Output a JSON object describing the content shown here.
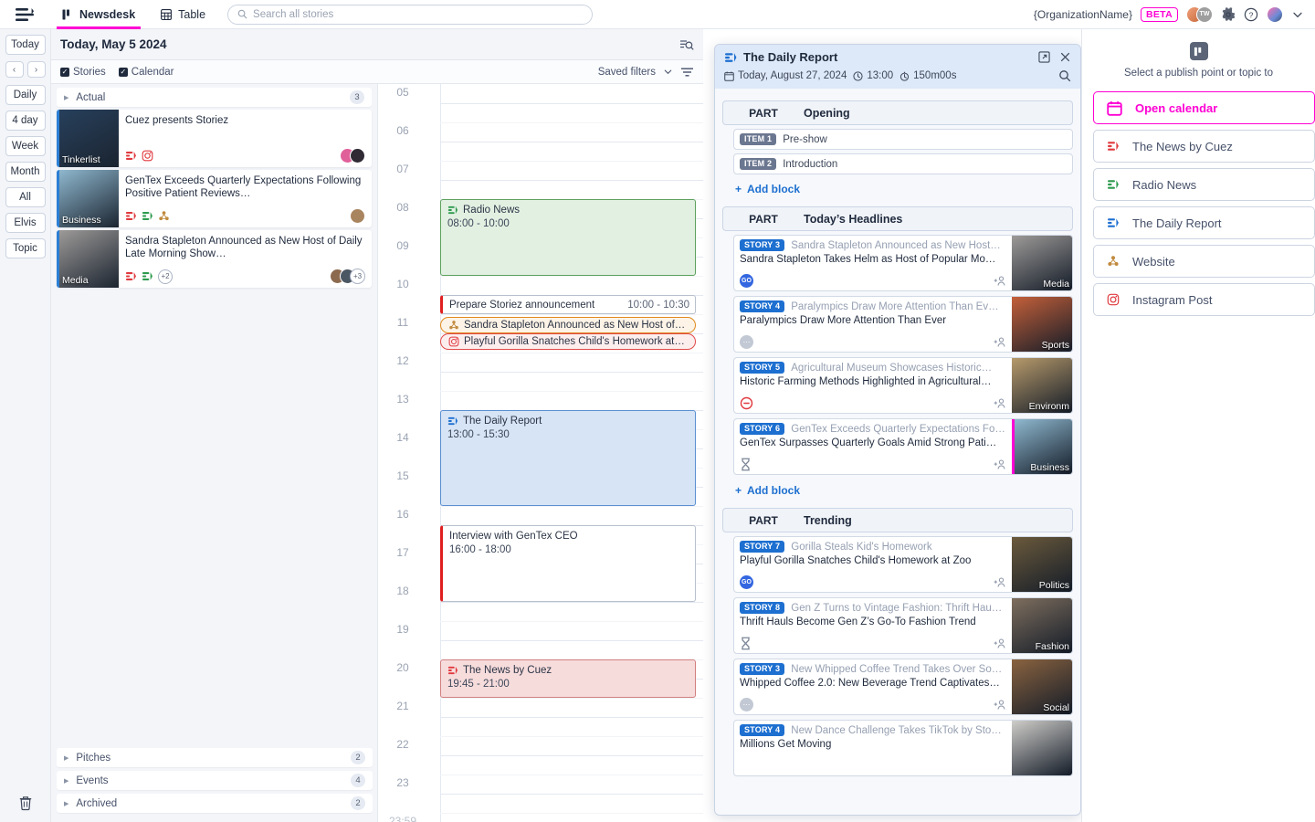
{
  "topbar": {
    "logo_icon": "menu-logo-icon",
    "tabs": [
      {
        "label": "Newsdesk",
        "icon": "board-icon",
        "active": true
      },
      {
        "label": "Table",
        "icon": "table-icon",
        "active": false
      }
    ],
    "search_placeholder": "Search all stories",
    "search_value": "",
    "org_name": "{OrganizationName}",
    "beta_label": "BETA",
    "collab_initials": "TW",
    "gear_icon": "gear-icon",
    "help_icon": "help-icon",
    "chevron_icon": "chevron-down-icon"
  },
  "rail": {
    "today_label": "Today",
    "prev_label": "‹",
    "next_label": "›",
    "views": [
      "Daily",
      "4 day",
      "Week",
      "Month",
      "All",
      "Elvis",
      "Topic"
    ],
    "trash_icon": "trash-icon"
  },
  "panel": {
    "date_title": "Today, May 5 2024",
    "search_settings_icon": "search-settings-icon"
  },
  "filterbar": {
    "stories_label": "Stories",
    "stories_checked": true,
    "calendar_label": "Calendar",
    "calendar_checked": true,
    "saved_filters_label": "Saved filters",
    "filter_icon": "filter-icon"
  },
  "stories": {
    "groups": [
      {
        "label": "Actual",
        "count": "3"
      }
    ],
    "cards": [
      {
        "title": "Cuez presents Storiez",
        "tag": "Tinkerlist",
        "accent": "#2b7fd4",
        "thumb_tone": "#27405c",
        "publish_icons": [
          "cuez-red-icon",
          "instagram-icon"
        ],
        "extra_count": "",
        "avatars": [
          "#e0609a",
          "#2f2a33"
        ],
        "avatar_extra": ""
      },
      {
        "title": "GenTex Exceeds Quarterly Expectations Following Positive Patient Reviews…",
        "tag": "Business",
        "accent": "#2b7fd4",
        "thumb_tone": "#8fb8cf",
        "publish_icons": [
          "cuez-red-icon",
          "cuez-green-icon",
          "website-icon"
        ],
        "extra_count": "",
        "avatars": [
          "#a9855f"
        ],
        "avatar_extra": ""
      },
      {
        "title": "Sandra Stapleton Announced as New Host of Daily Late Morning Show…",
        "tag": "Media",
        "accent": "#2b7fd4",
        "thumb_tone": "#9d9a98",
        "publish_icons": [
          "cuez-red-icon",
          "cuez-green-icon"
        ],
        "extra_count": "+2",
        "avatars": [
          "#8c6a4f",
          "#4b5763"
        ],
        "avatar_extra": "+3"
      }
    ],
    "bottom_groups": [
      {
        "label": "Pitches",
        "count": "2"
      },
      {
        "label": "Events",
        "count": "4"
      },
      {
        "label": "Archived",
        "count": "2"
      }
    ]
  },
  "calendar": {
    "hours": [
      "05",
      "06",
      "07",
      "08",
      "09",
      "10",
      "11",
      "12",
      "13",
      "14",
      "15",
      "16",
      "17",
      "18",
      "19",
      "20",
      "21",
      "22",
      "23"
    ],
    "end_label": "23:59",
    "events": [
      {
        "kind": "block",
        "style": "green",
        "icon": "cuez-green-icon",
        "title": "Radio News",
        "time": "08:00 - 10:00",
        "start": 8.0,
        "end": 10.0
      },
      {
        "kind": "task",
        "style": "task",
        "title": "Prepare Storiez announcement",
        "time": "10:00 - 10:30",
        "start": 10.5,
        "end": 11.0
      },
      {
        "kind": "pill",
        "style": "orange",
        "icon": "website-icon",
        "title": "Sandra Stapleton Announced as New Host of…",
        "start": 11.08
      },
      {
        "kind": "pill",
        "style": "red",
        "icon": "instagram-icon",
        "title": "Playful Gorilla Snatches Child's Homework at…",
        "start": 11.5
      },
      {
        "kind": "block",
        "style": "blue",
        "icon": "cuez-blue-icon",
        "title": "The Daily Report",
        "time": "13:00 - 15:30",
        "start": 13.5,
        "end": 16.0
      },
      {
        "kind": "task",
        "style": "task",
        "title": "Interview with GenTex CEO",
        "time": "16:00 - 18:00",
        "start": 16.5,
        "end": 18.5
      },
      {
        "kind": "block",
        "style": "red",
        "icon": "cuez-red-icon",
        "title": "The News by Cuez",
        "time": "19:45 - 21:00",
        "start": 20.0,
        "end": 21.0
      }
    ]
  },
  "rundown": {
    "title": "The Daily Report",
    "icon": "cuez-blue-icon",
    "open_external_icon": "open-external-icon",
    "close_icon": "close-icon",
    "date": "Today, August 27, 2024",
    "start_time": "13:00",
    "duration": "150m00s",
    "search_icon": "search-icon",
    "add_block_label": "Add block",
    "part_label": "PART",
    "parts": [
      {
        "name": "Opening",
        "items": [
          {
            "type": "item",
            "badge": "ITEM 1",
            "text": "Pre-show"
          },
          {
            "type": "item",
            "badge": "ITEM 2",
            "text": "Introduction"
          }
        ]
      },
      {
        "name": "Today’s Headlines",
        "items": [
          {
            "type": "story",
            "badge": "STORY 3",
            "slug": "Sandra Stapleton Announced as New Host…",
            "headline": "Sandra Stapleton Takes Helm as Host of Popular Mo…",
            "status_icon": "go-badge-icon",
            "tag": "Media",
            "thumb_tone": "#9d9a98",
            "assign_icon": "add-person-icon",
            "accent": ""
          },
          {
            "type": "story",
            "badge": "STORY 4",
            "slug": "Paralympics Draw More Attention Than Ev…",
            "headline": "Paralympics Draw More Attention Than Ever",
            "status_icon": "dots-icon",
            "tag": "Sports",
            "thumb_tone": "#c4603a",
            "assign_icon": "add-person-icon",
            "accent": ""
          },
          {
            "type": "story",
            "badge": "STORY 5",
            "slug": "Agricultural Museum Showcases Historic…",
            "headline": "Historic Farming Methods Highlighted in Agricultural…",
            "status_icon": "blocked-icon",
            "tag": "Environm",
            "thumb_tone": "#b79a6b",
            "assign_icon": "add-person-icon",
            "accent": ""
          },
          {
            "type": "story",
            "badge": "STORY 6",
            "slug": "GenTex Exceeds Quarterly Expectations Fo…",
            "headline": "GenTex Surpasses Quarterly Goals Amid Strong Pati…",
            "status_icon": "hourglass-icon",
            "tag": "Business",
            "thumb_tone": "#8fb8cf",
            "assign_icon": "add-person-icon",
            "accent": "#ff00d4"
          }
        ]
      },
      {
        "name": "Trending",
        "items": [
          {
            "type": "story",
            "badge": "STORY 7",
            "slug": "Gorilla Steals Kid's Homework",
            "headline": "Playful Gorilla Snatches Child's Homework at Zoo",
            "status_icon": "go-badge-icon",
            "tag": "Politics",
            "thumb_tone": "#6b5a3c",
            "assign_icon": "add-person-icon",
            "accent": ""
          },
          {
            "type": "story",
            "badge": "STORY 8",
            "slug": "Gen Z Turns to Vintage Fashion: Thrift Hau…",
            "headline": "Thrift Hauls Become Gen Z’s Go-To Fashion Trend",
            "status_icon": "hourglass-icon",
            "tag": "Fashion",
            "thumb_tone": "#7e6e5e",
            "assign_icon": "add-person-icon",
            "accent": ""
          },
          {
            "type": "story",
            "badge": "STORY 3",
            "slug": "New Whipped Coffee Trend Takes Over So…",
            "headline": "Whipped Coffee 2.0: New Beverage Trend Captivates…",
            "status_icon": "dots-icon",
            "tag": "Social",
            "thumb_tone": "#8a6340",
            "assign_icon": "add-person-icon",
            "accent": ""
          },
          {
            "type": "story",
            "badge": "STORY 4",
            "slug": "New Dance Challenge Takes TikTok by Sto…",
            "headline": "Millions Get Moving",
            "status_icon": "",
            "tag": "",
            "thumb_tone": "#cfcdc9",
            "assign_icon": "",
            "accent": ""
          }
        ]
      }
    ]
  },
  "publish_panel": {
    "board_icon": "board-icon",
    "hint": "Select a publish point or topic to",
    "items": [
      {
        "label": "Open calendar",
        "icon": "calendar-icon",
        "primary": true
      },
      {
        "label": "The News by Cuez",
        "icon": "cuez-red-icon",
        "primary": false
      },
      {
        "label": "Radio News",
        "icon": "cuez-green-icon",
        "primary": false
      },
      {
        "label": "The Daily Report",
        "icon": "cuez-blue-icon",
        "primary": false
      },
      {
        "label": "Website",
        "icon": "website-icon",
        "primary": false
      },
      {
        "label": "Instagram Post",
        "icon": "instagram-icon",
        "primary": false
      }
    ]
  }
}
